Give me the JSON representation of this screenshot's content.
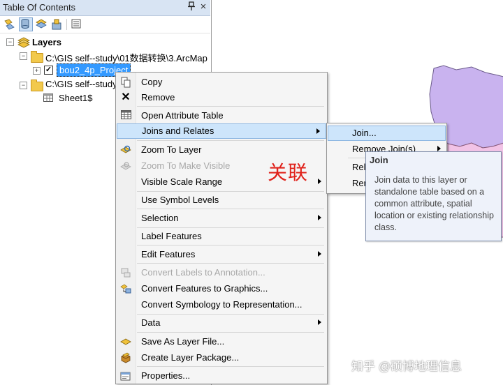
{
  "toc": {
    "title": "Table Of Contents",
    "pin_glyph": "↕",
    "close_glyph": "×",
    "toolbar_icons": [
      "list-by-drawing-order-icon",
      "list-by-source-icon",
      "list-by-visibility-icon",
      "list-by-selection-icon",
      "options-icon"
    ],
    "tree": {
      "root_label": "Layers",
      "items": [
        {
          "label": "C:\\GIS  self--study\\01数据转换\\3.ArcMap",
          "type": "folder"
        },
        {
          "label": "bou2_4p_Project",
          "type": "layer",
          "checked": true,
          "selected": true
        },
        {
          "label": "C:\\GIS  self--study",
          "type": "folder"
        },
        {
          "label": "Sheet1$",
          "type": "table"
        }
      ]
    }
  },
  "context_menu": {
    "items": [
      {
        "label": "Copy",
        "icon": "copy-icon",
        "enabled": true
      },
      {
        "label": "Remove",
        "icon": "remove-x-icon",
        "enabled": true
      },
      {
        "label": "Open Attribute Table",
        "icon": "table-icon",
        "enabled": true
      },
      {
        "label": "Joins and Relates",
        "enabled": true,
        "submenu": true,
        "highlighted": true
      },
      {
        "label": "Zoom To Layer",
        "icon": "zoom-to-layer-icon",
        "enabled": true
      },
      {
        "label": "Zoom To Make Visible",
        "icon": "zoom-visible-icon",
        "enabled": false
      },
      {
        "label": "Visible Scale Range",
        "enabled": true,
        "submenu": true
      },
      {
        "label": "Use Symbol Levels",
        "enabled": true
      },
      {
        "label": "Selection",
        "enabled": true,
        "submenu": true
      },
      {
        "label": "Label Features",
        "enabled": true
      },
      {
        "label": "Edit Features",
        "enabled": true,
        "submenu": true
      },
      {
        "label": "Convert Labels to Annotation...",
        "icon": "convert-labels-icon",
        "enabled": false
      },
      {
        "label": "Convert Features to Graphics...",
        "icon": "convert-graphics-icon",
        "enabled": true
      },
      {
        "label": "Convert Symbology to Representation...",
        "enabled": true
      },
      {
        "label": "Data",
        "enabled": true,
        "submenu": true
      },
      {
        "label": "Save As Layer File...",
        "icon": "layer-file-icon",
        "enabled": true
      },
      {
        "label": "Create Layer Package...",
        "icon": "layer-package-icon",
        "enabled": true
      },
      {
        "label": "Properties...",
        "icon": "properties-icon",
        "enabled": true
      }
    ]
  },
  "submenu": {
    "items": [
      {
        "label": "Join...",
        "highlighted": true
      },
      {
        "label": "Remove Join(s)",
        "submenu": true
      },
      {
        "label": "Rel"
      },
      {
        "label": "Rer"
      }
    ]
  },
  "tooltip": {
    "title": "Join",
    "body": "Join data to this layer or standalone table based on a common attribute, spatial location or existing relationship class."
  },
  "annotation": "关联",
  "watermark": "知乎 @硕博地理信息",
  "colors": {
    "selection": "#cde5fb",
    "highlight_border": "#8cb6e2",
    "map_polygon_purple": "#c9b3ef",
    "map_polygon_pink": "#f2c3e6",
    "annotation_red": "#e0221b"
  }
}
